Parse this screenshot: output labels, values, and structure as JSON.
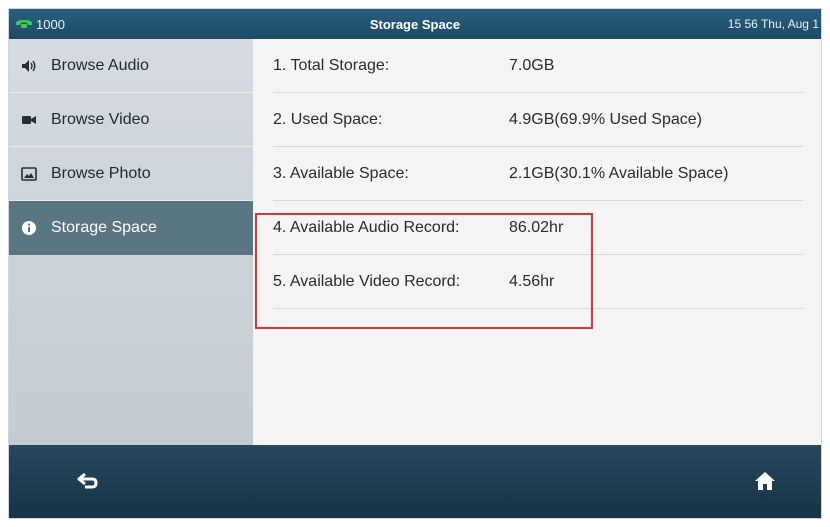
{
  "status_bar": {
    "line_label": "1000",
    "title": "Storage Space",
    "clock": "15 56 Thu, Aug 1"
  },
  "sidebar": {
    "items": [
      {
        "label": "Browse Audio",
        "icon": "speaker-icon",
        "active": false
      },
      {
        "label": "Browse Video",
        "icon": "video-camera-icon",
        "active": false
      },
      {
        "label": "Browse Photo",
        "icon": "photo-icon",
        "active": false
      },
      {
        "label": "Storage Space",
        "icon": "info-icon",
        "active": true
      }
    ]
  },
  "storage": {
    "rows": [
      {
        "label": "1. Total Storage:",
        "value": "7.0GB"
      },
      {
        "label": "2. Used Space:",
        "value": "4.9GB(69.9% Used Space)"
      },
      {
        "label": "3. Available Space:",
        "value": "2.1GB(30.1% Available Space)"
      },
      {
        "label": "4. Available Audio Record:",
        "value": "86.02hr"
      },
      {
        "label": "5. Available Video Record:",
        "value": "4.56hr"
      }
    ]
  },
  "bottom_bar": {
    "back_icon": "back-arrow-icon",
    "home_icon": "home-icon"
  },
  "colors": {
    "accent": "#1c4a66",
    "active_item": "#5b7683",
    "highlight_box": "#e0342f",
    "line_icon": "#3ccf4e"
  }
}
